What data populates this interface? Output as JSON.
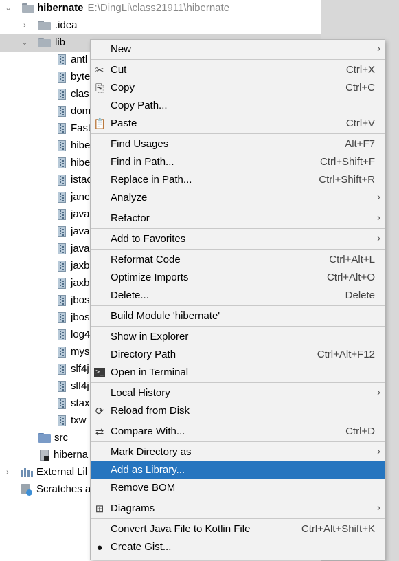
{
  "tree": {
    "root": {
      "name": "hibernate",
      "path": "E:\\DingLi\\class21911\\hibernate"
    },
    "idea": ".idea",
    "lib": "lib",
    "jars": [
      "antl",
      "byte",
      "clas",
      "dom",
      "Fast",
      "hibe",
      "hibe",
      "istac",
      "janc",
      "java",
      "java",
      "java",
      "jaxb",
      "jaxb",
      "jbos",
      "jbos",
      "log4",
      "mys",
      "slf4j",
      "slf4j",
      "stax",
      "txw"
    ],
    "src": "src",
    "iml": "hiberna",
    "external": "External Lil",
    "scratches": "Scratches a"
  },
  "menu": {
    "items": [
      {
        "label": "New",
        "shortcut": "",
        "submenu": true,
        "icon": ""
      },
      {
        "label": "Cut",
        "shortcut": "Ctrl+X",
        "submenu": false,
        "icon": "✂"
      },
      {
        "label": "Copy",
        "shortcut": "Ctrl+C",
        "submenu": false,
        "icon": "⎘"
      },
      {
        "label": "Copy Path...",
        "shortcut": "",
        "submenu": false,
        "icon": ""
      },
      {
        "label": "Paste",
        "shortcut": "Ctrl+V",
        "submenu": false,
        "icon": "📋"
      },
      {
        "label": "Find Usages",
        "shortcut": "Alt+F7",
        "submenu": false,
        "icon": ""
      },
      {
        "label": "Find in Path...",
        "shortcut": "Ctrl+Shift+F",
        "submenu": false,
        "icon": ""
      },
      {
        "label": "Replace in Path...",
        "shortcut": "Ctrl+Shift+R",
        "submenu": false,
        "icon": ""
      },
      {
        "label": "Analyze",
        "shortcut": "",
        "submenu": true,
        "icon": ""
      },
      {
        "label": "Refactor",
        "shortcut": "",
        "submenu": true,
        "icon": ""
      },
      {
        "label": "Add to Favorites",
        "shortcut": "",
        "submenu": true,
        "icon": ""
      },
      {
        "label": "Reformat Code",
        "shortcut": "Ctrl+Alt+L",
        "submenu": false,
        "icon": ""
      },
      {
        "label": "Optimize Imports",
        "shortcut": "Ctrl+Alt+O",
        "submenu": false,
        "icon": ""
      },
      {
        "label": "Delete...",
        "shortcut": "Delete",
        "submenu": false,
        "icon": ""
      },
      {
        "label": "Build Module 'hibernate'",
        "shortcut": "",
        "submenu": false,
        "icon": ""
      },
      {
        "label": "Show in Explorer",
        "shortcut": "",
        "submenu": false,
        "icon": ""
      },
      {
        "label": "Directory Path",
        "shortcut": "Ctrl+Alt+F12",
        "submenu": false,
        "icon": ""
      },
      {
        "label": "Open in Terminal",
        "shortcut": "",
        "submenu": false,
        "icon": ">_"
      },
      {
        "label": "Local History",
        "shortcut": "",
        "submenu": true,
        "icon": ""
      },
      {
        "label": "Reload from Disk",
        "shortcut": "",
        "submenu": false,
        "icon": "⟳"
      },
      {
        "label": "Compare With...",
        "shortcut": "Ctrl+D",
        "submenu": false,
        "icon": "⇄"
      },
      {
        "label": "Mark Directory as",
        "shortcut": "",
        "submenu": true,
        "icon": ""
      },
      {
        "label": "Add as Library...",
        "shortcut": "",
        "submenu": false,
        "icon": "",
        "highlighted": true
      },
      {
        "label": "Remove BOM",
        "shortcut": "",
        "submenu": false,
        "icon": ""
      },
      {
        "label": "Diagrams",
        "shortcut": "",
        "submenu": true,
        "icon": "⊞"
      },
      {
        "label": "Convert Java File to Kotlin File",
        "shortcut": "Ctrl+Alt+Shift+K",
        "submenu": false,
        "icon": ""
      },
      {
        "label": "Create Gist...",
        "shortcut": "",
        "submenu": false,
        "icon": "●"
      }
    ]
  },
  "colors": {
    "highlight": "#2675bf",
    "folder": "#a9b2bb",
    "src_folder": "#7a9bc7"
  }
}
